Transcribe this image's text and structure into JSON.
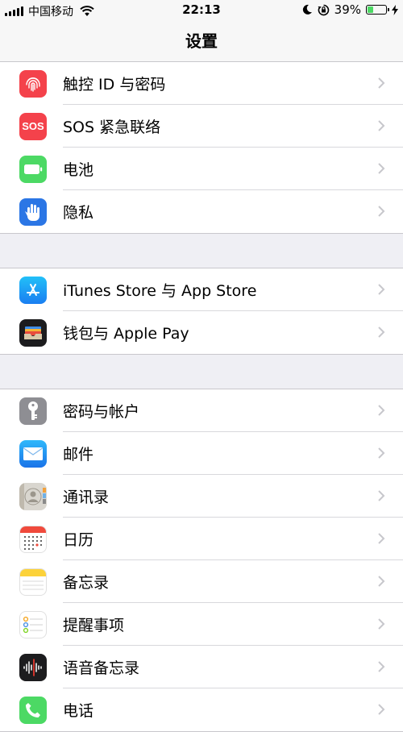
{
  "status_bar": {
    "carrier": "中国移动",
    "time": "22:13",
    "battery_percent": "39%",
    "battery_level": 0.39
  },
  "nav": {
    "title": "设置"
  },
  "groups": [
    {
      "items": [
        {
          "label": "触控 ID 与密码",
          "icon": "fingerprint-icon",
          "color": "#f4424b"
        },
        {
          "label": "SOS 紧急联络",
          "icon": "sos-icon",
          "icon_text": "SOS",
          "color": "#f4424b"
        },
        {
          "label": "电池",
          "icon": "battery-icon",
          "color": "#4cd964"
        },
        {
          "label": "隐私",
          "icon": "privacy-hand-icon",
          "color": "#2b76e5"
        }
      ]
    },
    {
      "items": [
        {
          "label": "iTunes Store 与 App Store",
          "icon": "app-store-icon",
          "color": "#1e9bf5"
        },
        {
          "label": "钱包与 Apple Pay",
          "icon": "wallet-icon",
          "color": "#1c1c1e"
        }
      ]
    },
    {
      "items": [
        {
          "label": "密码与帐户",
          "icon": "key-icon",
          "color": "#8e8e93"
        },
        {
          "label": "邮件",
          "icon": "mail-icon",
          "color": "#2e9bf5"
        },
        {
          "label": "通讯录",
          "icon": "contacts-icon",
          "color": "#d9d6cf"
        },
        {
          "label": "日历",
          "icon": "calendar-icon",
          "color": "#ffffff"
        },
        {
          "label": "备忘录",
          "icon": "notes-icon",
          "color": "#ffffff"
        },
        {
          "label": "提醒事项",
          "icon": "reminders-icon",
          "color": "#ffffff"
        },
        {
          "label": "语音备忘录",
          "icon": "voice-memos-icon",
          "color": "#1c1c1e"
        },
        {
          "label": "电话",
          "icon": "phone-icon",
          "color": "#4cd964"
        }
      ]
    }
  ]
}
